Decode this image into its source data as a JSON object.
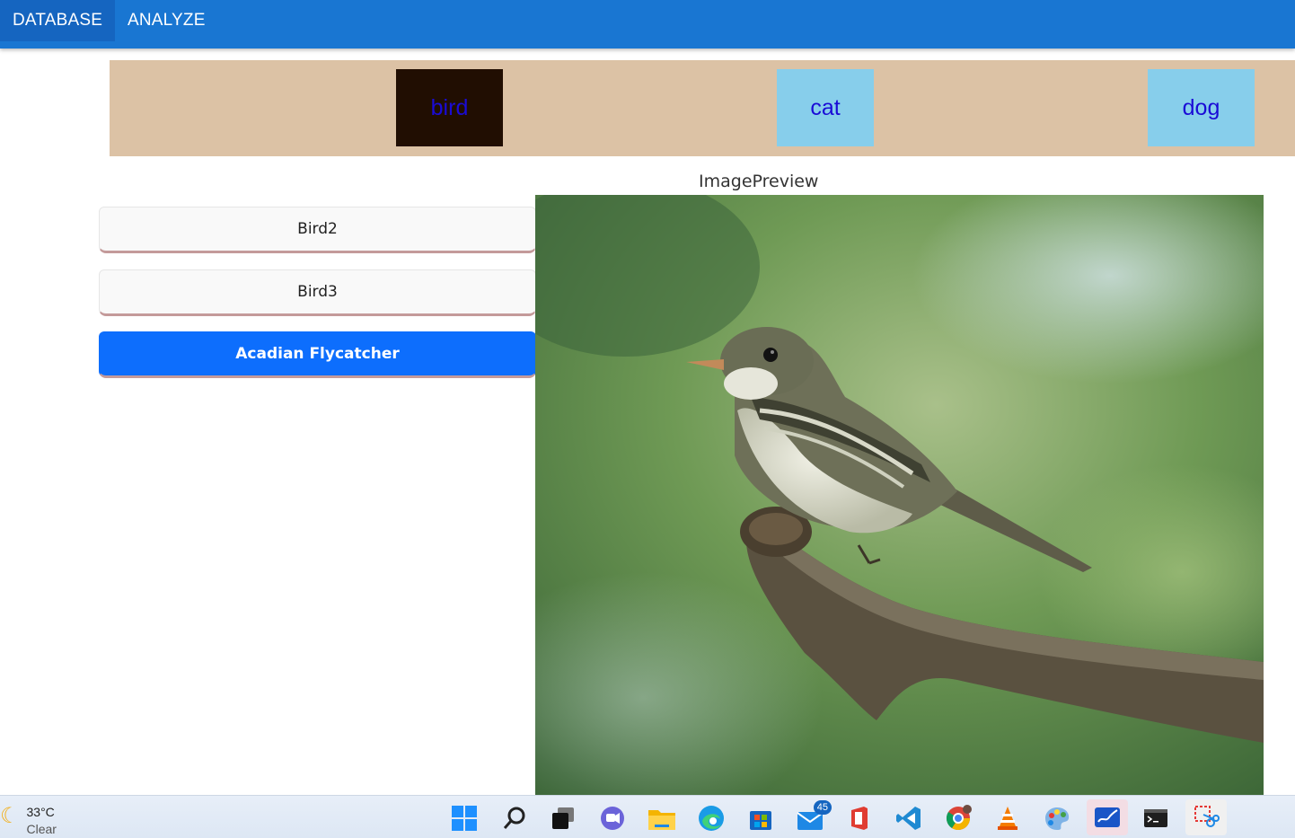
{
  "nav": {
    "database": "DATABASE",
    "analyze": "ANALYZE"
  },
  "categories": [
    {
      "label": "bird",
      "selected": true
    },
    {
      "label": "cat",
      "selected": false
    },
    {
      "label": "dog",
      "selected": false
    }
  ],
  "list": {
    "items": [
      {
        "label": "Bird2",
        "selected": false
      },
      {
        "label": "Bird3",
        "selected": false
      },
      {
        "label": "Acadian Flycatcher",
        "selected": true
      }
    ]
  },
  "preview": {
    "title": "ImagePreview"
  },
  "taskbar": {
    "weather": {
      "temp": "33°C",
      "condition": "Clear"
    },
    "mail_badge": "45",
    "icons": [
      "windows-start-icon",
      "search-icon",
      "task-view-icon",
      "teams-chat-icon",
      "file-explorer-icon",
      "edge-icon",
      "store-icon",
      "mail-icon",
      "office-icon",
      "vscode-icon",
      "chrome-icon",
      "vlc-icon",
      "paint-icon",
      "whiteboard-icon",
      "terminal-icon",
      "snipping-tool-icon"
    ]
  },
  "colors": {
    "appbar": "#1976d2",
    "category_strip": "#dcc2a5",
    "category_selected": "#210e02",
    "category_normal": "#87ceeb",
    "list_selected": "#0d6efd"
  }
}
